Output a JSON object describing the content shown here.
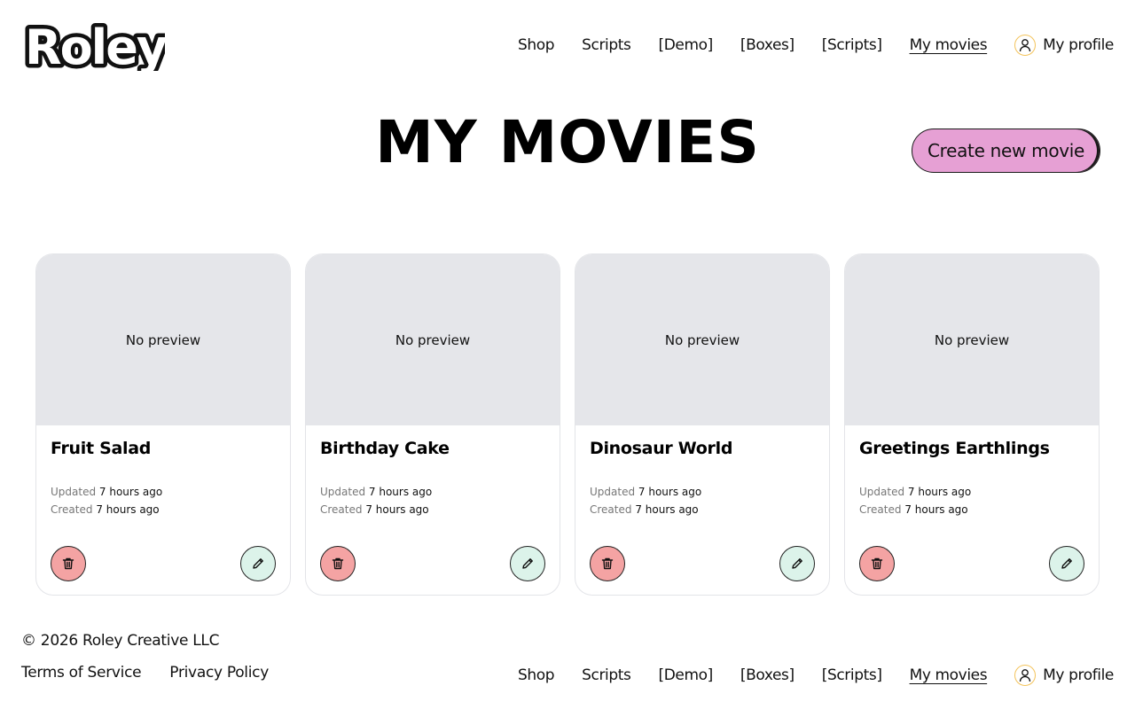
{
  "brand": {
    "logo_text": "Roley"
  },
  "nav": {
    "items": [
      "Shop",
      "Scripts",
      "[Demo]",
      "[Boxes]",
      "[Scripts]",
      "My movies"
    ],
    "active": "My movies",
    "profile_label": "My profile"
  },
  "page": {
    "title": "MY MOVIES",
    "create_button": "Create new movie"
  },
  "movies": [
    {
      "title": "Fruit Salad",
      "preview": "No preview",
      "updated_label": "Updated",
      "updated": "7 hours ago",
      "created_label": "Created",
      "created": "7 hours ago"
    },
    {
      "title": "Birthday Cake",
      "preview": "No preview",
      "updated_label": "Updated",
      "updated": "7 hours ago",
      "created_label": "Created",
      "created": "7 hours ago"
    },
    {
      "title": "Dinosaur World",
      "preview": "No preview",
      "updated_label": "Updated",
      "updated": "7 hours ago",
      "created_label": "Created",
      "created": "7 hours ago"
    },
    {
      "title": "Greetings Earthlings",
      "preview": "No preview",
      "updated_label": "Updated",
      "updated": "7 hours ago",
      "created_label": "Created",
      "created": "7 hours ago"
    }
  ],
  "card_icons": {
    "delete": "trash-icon",
    "edit": "pencil-icon"
  },
  "footer": {
    "copyright": "© 2026 Roley Creative LLC",
    "links": [
      "Terms of Service",
      "Privacy Policy"
    ]
  },
  "colors": {
    "create_button": "#e6a0d4",
    "delete_button": "#f4a3a3",
    "edit_button": "#dcf3ea",
    "preview_bg": "#e5e6ea",
    "avatar_ring": "#f3c35a"
  }
}
